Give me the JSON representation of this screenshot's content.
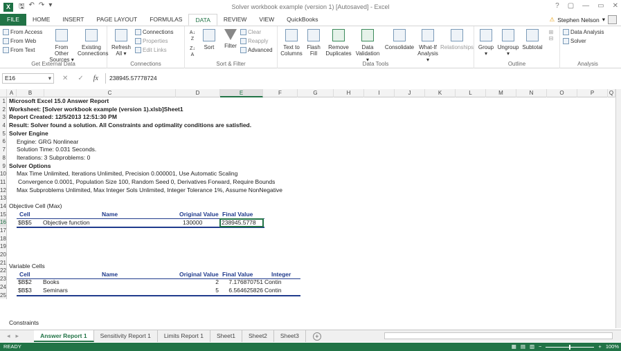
{
  "app": {
    "title": "Solver workbook example (version 1) [Autosaved] - Excel",
    "logo": "X",
    "window_controls": [
      "?",
      "▢",
      "—",
      "▭",
      "✕"
    ],
    "quick_access": [
      "save-icon",
      "undo-icon",
      "redo-icon",
      "customize-icon"
    ]
  },
  "menu": {
    "tabs": [
      "FILE",
      "HOME",
      "INSERT",
      "PAGE LAYOUT",
      "FORMULAS",
      "DATA",
      "REVIEW",
      "VIEW",
      "QuickBooks"
    ],
    "active": "DATA",
    "user": "Stephen Nelson"
  },
  "ribbon": {
    "get_external": {
      "label": "Get External Data",
      "from_access": "From Access",
      "from_web": "From Web",
      "from_text": "From Text",
      "from_other": "From Other",
      "from_other2": "Sources",
      "existing": "Existing",
      "existing2": "Connections"
    },
    "connections": {
      "label": "Connections",
      "refresh": "Refresh",
      "refresh2": "All",
      "connections": "Connections",
      "properties": "Properties",
      "edit_links": "Edit Links"
    },
    "sort_filter": {
      "label": "Sort & Filter",
      "sort": "Sort",
      "filter": "Filter",
      "clear": "Clear",
      "reapply": "Reapply",
      "advanced": "Advanced"
    },
    "data_tools": {
      "label": "Data Tools",
      "text_to_columns": "Text to",
      "text_to_columns2": "Columns",
      "flash": "Flash",
      "flash2": "Fill",
      "remove": "Remove",
      "remove2": "Duplicates",
      "validation": "Data",
      "validation2": "Validation",
      "consolidate": "Consolidate",
      "whatif": "What-If",
      "whatif2": "Analysis",
      "relationships": "Relationships"
    },
    "outline": {
      "label": "Outline",
      "group": "Group",
      "ungroup": "Ungroup",
      "subtotal": "Subtotal"
    },
    "analysis": {
      "label": "Analysis",
      "data_analysis": "Data Analysis",
      "solver": "Solver"
    }
  },
  "formula_bar": {
    "name_box": "E16",
    "formula": "238945.57778724"
  },
  "columns": [
    "A",
    "B",
    "C",
    "D",
    "E",
    "F",
    "G",
    "H",
    "I",
    "J",
    "K",
    "L",
    "M",
    "N",
    "O",
    "P",
    "Q"
  ],
  "selected_column": "E",
  "rows": [
    "1",
    "2",
    "3",
    "4",
    "5",
    "6",
    "7",
    "8",
    "9",
    "10",
    "11",
    "12",
    "13",
    "14",
    "15",
    "16",
    "17",
    "18",
    "19",
    "20",
    "21",
    "22",
    "23",
    "24",
    "25"
  ],
  "selected_row": "16",
  "report": {
    "line1": "Microsoft Excel 15.0 Answer Report",
    "line2": "Worksheet: [Solver workbook example (version 1).xlsb]Sheet1",
    "line3": "Report Created: 12/5/2013 12:51:30 PM",
    "line4": "Result: Solver found a solution.  All Constraints and optimality conditions are satisfied.",
    "line5": "Solver Engine",
    "line6": "Engine: GRG Nonlinear",
    "line7": "Solution Time: 0.031 Seconds.",
    "line8": "Iterations: 3 Subproblems: 0",
    "line9": "Solver Options",
    "line10": "Max Time Unlimited,  Iterations Unlimited, Precision 0.000001, Use Automatic Scaling",
    "line11": "Convergence 0.0001, Population Size 100, Random Seed 0, Derivatives Forward, Require Bounds",
    "line12": "Max Subproblems Unlimited, Max Integer Sols Unlimited, Integer Tolerance 1%, Assume NonNegative",
    "objective_title": "Objective Cell (Max)",
    "obj_headers": {
      "cell": "Cell",
      "name": "Name",
      "orig": "Original Value",
      "final": "Final Value"
    },
    "obj_row": {
      "cell": "$B$5",
      "name": "Objective function",
      "orig": "130000",
      "final": "238945.5778"
    },
    "variable_title": "Variable Cells",
    "var_headers": {
      "cell": "Cell",
      "name": "Name",
      "orig": "Original Value",
      "final": "Final Value",
      "integer": "Integer"
    },
    "var_rows": [
      {
        "cell": "$B$2",
        "name": "Books",
        "orig": "2",
        "final": "7.176870751",
        "integer": "Contin"
      },
      {
        "cell": "$B$3",
        "name": "Seminars",
        "orig": "5",
        "final": "6.564625826",
        "integer": "Contin"
      }
    ],
    "constraints_title": "Constraints"
  },
  "sheet_tabs": [
    "Answer Report 1",
    "Sensitivity Report 1",
    "Limits Report 1",
    "Sheet1",
    "Sheet2",
    "Sheet3"
  ],
  "active_sheet": "Answer Report 1",
  "status": {
    "ready": "READY",
    "zoom": "100%"
  },
  "colors": {
    "excel_green": "#217346",
    "header_blue": "#1f3a8c"
  }
}
